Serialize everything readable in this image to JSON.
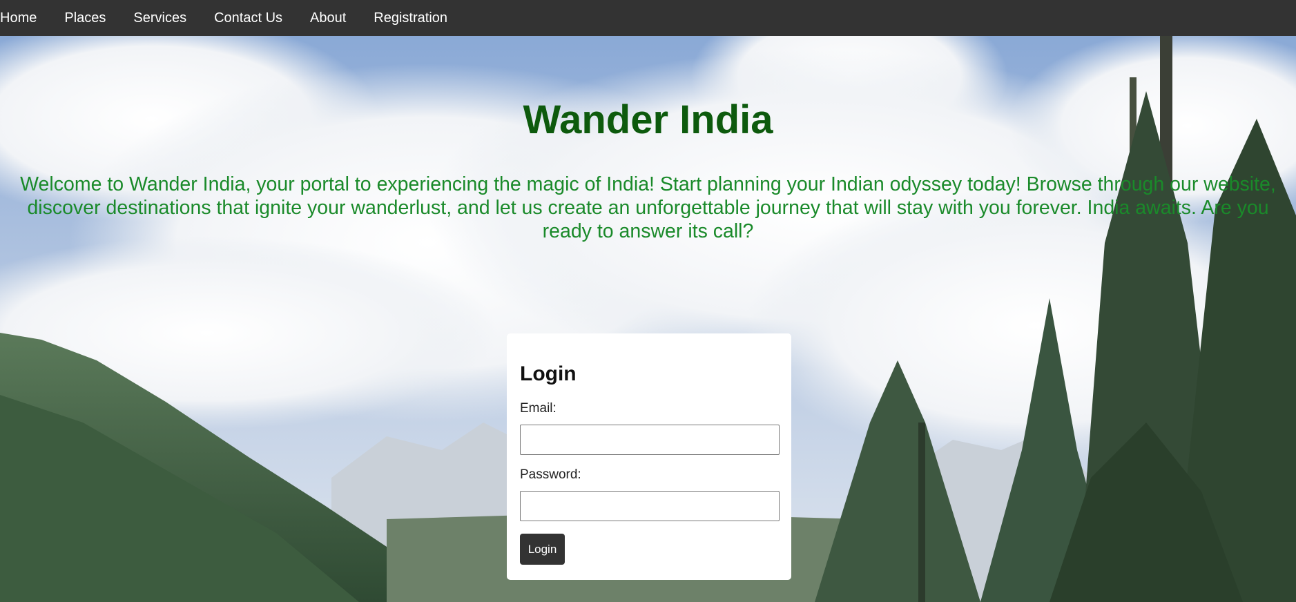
{
  "nav": {
    "items": [
      {
        "label": "Home"
      },
      {
        "label": "Places"
      },
      {
        "label": "Services"
      },
      {
        "label": "Contact Us"
      },
      {
        "label": "About"
      },
      {
        "label": "Registration"
      }
    ]
  },
  "hero": {
    "title": "Wander India",
    "welcome": "Welcome to Wander India, your portal to experiencing the magic of India! Start planning your Indian odyssey today! Browse through our website, discover destinations that ignite your wanderlust, and let us create an unforgettable journey that will stay with you forever. India awaits. Are you ready to answer its call?"
  },
  "login": {
    "heading": "Login",
    "email_label": "Email:",
    "email_value": "",
    "password_label": "Password:",
    "password_value": "",
    "button_label": "Login"
  },
  "colors": {
    "navbar": "#333333",
    "title": "#0d5a0d",
    "welcome_text": "#1a8a2a",
    "button": "#333333"
  }
}
